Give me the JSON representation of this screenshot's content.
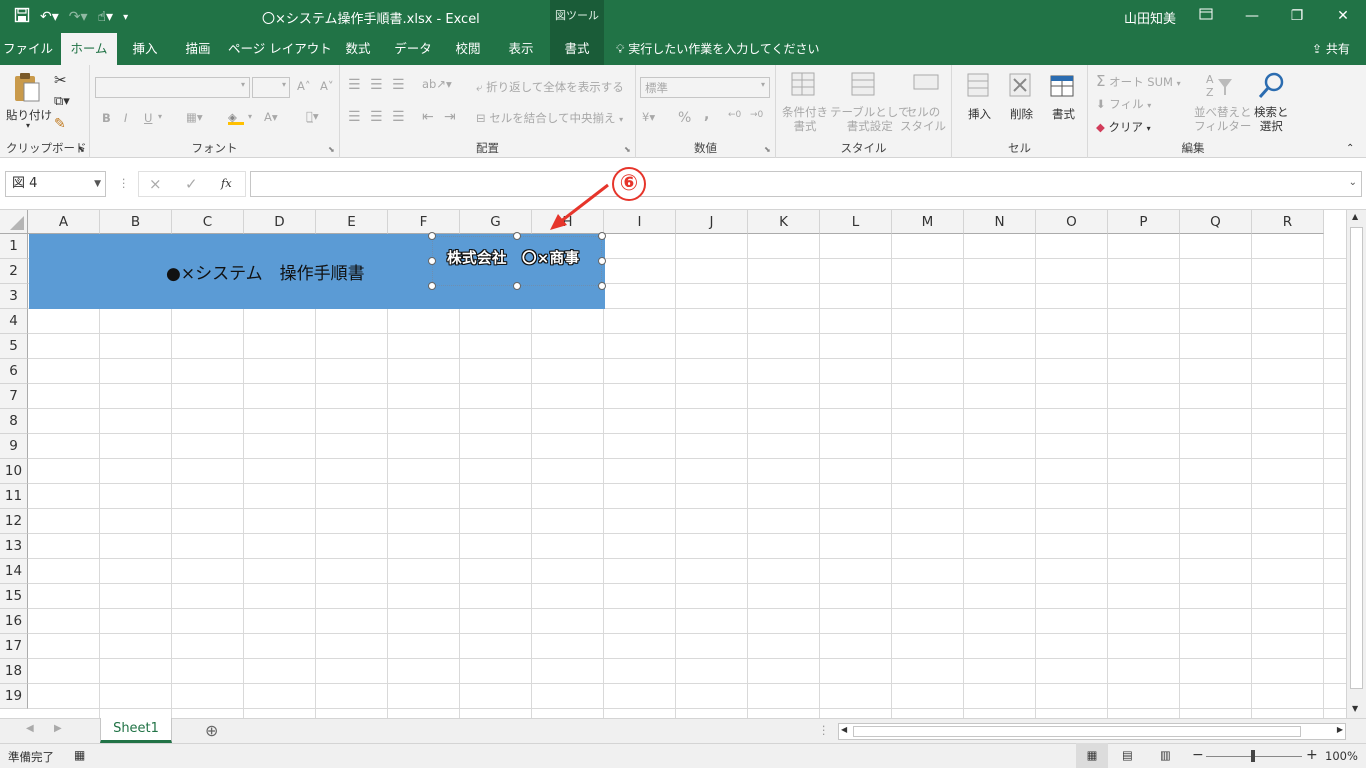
{
  "window": {
    "title": "〇×システム操作手順書.xlsx  -  Excel",
    "context_tab_group": "図ツール",
    "user": "山田知美"
  },
  "ribbon_tabs": [
    "ファイル",
    "ホーム",
    "挿入",
    "描画",
    "ページ レイアウト",
    "数式",
    "データ",
    "校閲",
    "表示",
    "書式"
  ],
  "active_tab": "ホーム",
  "tell_me": "実行したい作業を入力してください",
  "share": "共有",
  "ribbon": {
    "clipboard": {
      "paste": "貼り付け",
      "label": "クリップボード"
    },
    "font": {
      "bold": "B",
      "italic": "I",
      "underline": "U",
      "label": "フォント"
    },
    "alignment": {
      "wrap": "折り返して全体を表示する",
      "merge": "セルを結合して中央揃え",
      "label": "配置"
    },
    "number": {
      "format": "標準",
      "percent": "%",
      "comma": ",",
      "label": "数値"
    },
    "styles": {
      "conditional": "条件付き\n書式",
      "table": "テーブルとして\n書式設定",
      "cell": "セルの\nスタイル",
      "label": "スタイル"
    },
    "cells": {
      "insert": "挿入",
      "delete": "削除",
      "format": "書式",
      "label": "セル"
    },
    "editing": {
      "autosum": "オート SUM",
      "fill": "フィル",
      "clear": "クリア",
      "sort": "並べ替えと\nフィルター",
      "find": "検索と\n選択",
      "label": "編集"
    }
  },
  "formula_bar": {
    "name_box": "図 4",
    "fx": "fx",
    "cancel": "×",
    "enter": "✓"
  },
  "columns": [
    "A",
    "B",
    "C",
    "D",
    "E",
    "F",
    "G",
    "H",
    "I",
    "J",
    "K",
    "L",
    "M",
    "N",
    "O",
    "P",
    "Q",
    "R"
  ],
  "rows": [
    "1",
    "2",
    "3",
    "4",
    "5",
    "6",
    "7",
    "8",
    "9",
    "10",
    "11",
    "12",
    "13",
    "14",
    "15",
    "16",
    "17",
    "18",
    "19"
  ],
  "sheet": {
    "banner_text": "●×システム　操作手順書",
    "banner_color": "#5b9bd5",
    "shape_text": "株式会社　〇×商事"
  },
  "annotation": {
    "number": "⑥",
    "color": "#e6352b"
  },
  "sheet_tabs": [
    "Sheet1"
  ],
  "status": {
    "ready": "準備完了",
    "zoom": "100%"
  },
  "colors": {
    "accent": "#217346"
  }
}
